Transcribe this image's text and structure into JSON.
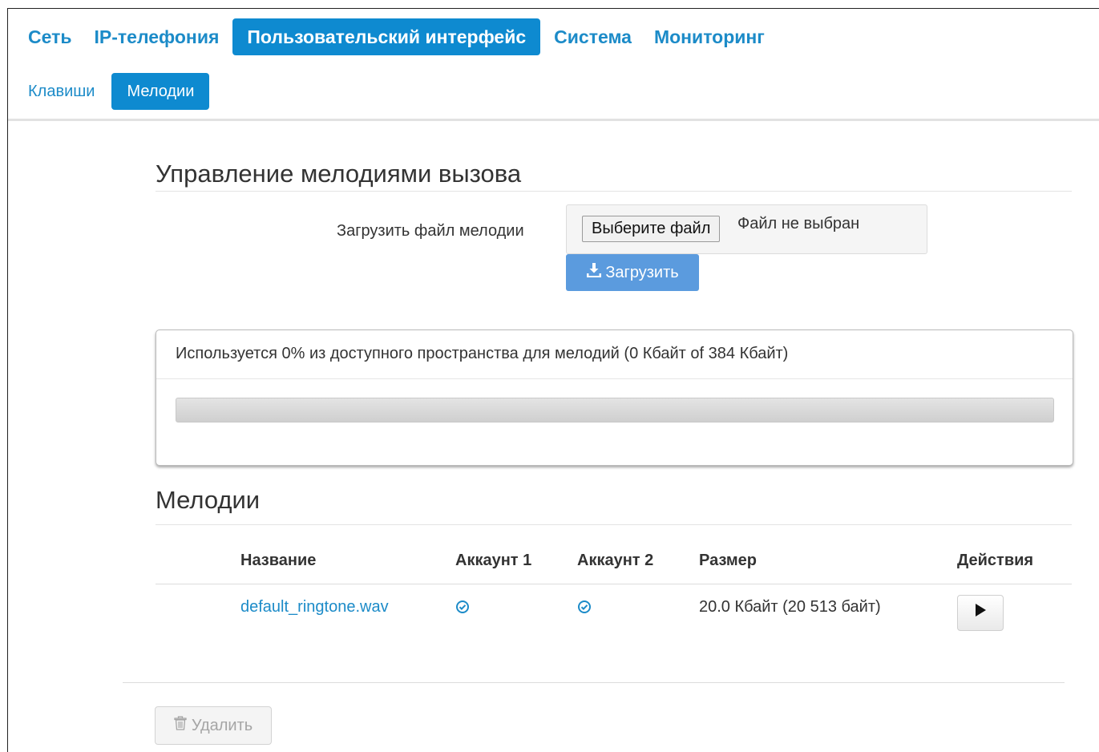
{
  "nav": {
    "main_tabs": [
      {
        "label": "Сеть",
        "active": false
      },
      {
        "label": "IP-телефония",
        "active": false
      },
      {
        "label": "Пользовательский интерфейс",
        "active": true
      },
      {
        "label": "Система",
        "active": false
      },
      {
        "label": "Мониторинг",
        "active": false
      }
    ],
    "sub_tabs": [
      {
        "label": "Клавиши",
        "active": false
      },
      {
        "label": "Мелодии",
        "active": true
      }
    ]
  },
  "management": {
    "title": "Управление мелодиями вызова",
    "upload_label": "Загрузить файл мелодии",
    "choose_file_button": "Выберите файл",
    "file_status": "Файл не выбран",
    "upload_button": "Загрузить",
    "upload_icon": "download-icon"
  },
  "usage": {
    "text": "Используется 0% из доступного пространства для мелодий (0 Кбайт of 384 Кбайт)",
    "percent": 0
  },
  "melodies": {
    "title": "Мелодии",
    "columns": [
      "Название",
      "Аккаунт 1",
      "Аккаунт 2",
      "Размер",
      "Действия"
    ],
    "rows": [
      {
        "name": "default_ringtone.wav",
        "account1": "check-circle-icon",
        "account2": "check-circle-icon",
        "size": "20.0 Кбайт (20 513 байт)",
        "action": "play-icon"
      }
    ]
  },
  "footer": {
    "delete_button": "Удалить",
    "delete_icon": "trash-icon"
  },
  "colors": {
    "accent": "#0e8ad0",
    "link": "#1c8bc8",
    "upload_button": "#5b9bde"
  }
}
